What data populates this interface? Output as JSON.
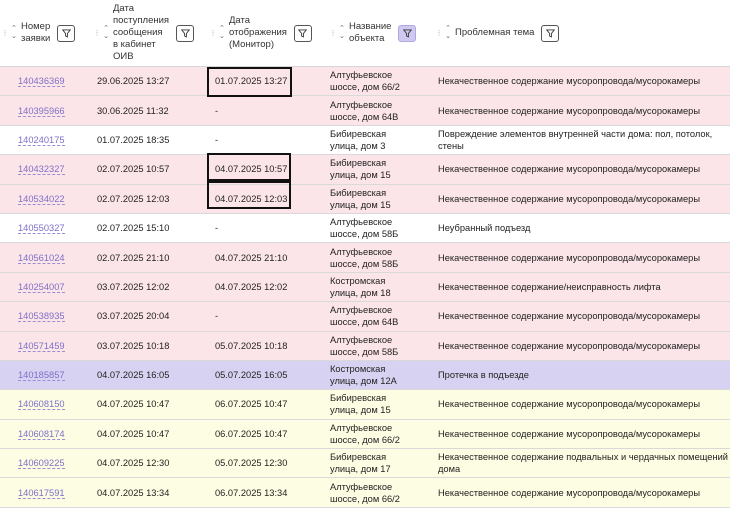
{
  "header": {
    "columns": [
      {
        "label_lines": [
          "Номер",
          "заявки"
        ],
        "filter": true,
        "filter_active": false
      },
      {
        "label_lines": [
          "Дата",
          "поступления",
          "сообщения",
          "в кабинет",
          "ОИВ"
        ],
        "filter": true,
        "filter_active": false
      },
      {
        "label_lines": [
          "Дата",
          "отображения",
          "(Монитор)"
        ],
        "filter": true,
        "filter_active": false
      },
      {
        "label_lines": [
          "Название",
          "объекта"
        ],
        "filter": true,
        "filter_active": true
      },
      {
        "label_lines": [
          "Проблемная тема"
        ],
        "filter": true,
        "filter_active": false
      }
    ]
  },
  "colors": {
    "pink": "#fce5e9",
    "violet": "#d7d2f1",
    "yellow": "#fdfde3",
    "link": "#7d6fc8"
  },
  "rows": [
    {
      "number": "140436369",
      "received": "29.06.2025 13:27",
      "displayed": "01.07.2025 13:27",
      "object": [
        "Алтуфьевское",
        "шоссе, дом 66/2"
      ],
      "topic": [
        "Некачественное содержание мусоропровода/мусорокамеры"
      ],
      "style": "pink"
    },
    {
      "number": "140395966",
      "received": "30.06.2025 11:32",
      "displayed": "-",
      "object": [
        "Алтуфьевское",
        "шоссе, дом 64В"
      ],
      "topic": [
        "Некачественное содержание мусоропровода/мусорокамеры"
      ],
      "style": "pink"
    },
    {
      "number": "140240175",
      "received": "01.07.2025 18:35",
      "displayed": "-",
      "object": [
        "Бибиревская",
        "улица, дом 3"
      ],
      "topic": [
        "Повреждение элементов внутренней части дома: пол, потолок,",
        "стены"
      ],
      "style": "white"
    },
    {
      "number": "140432327",
      "received": "02.07.2025 10:57",
      "displayed": "04.07.2025 10:57",
      "object": [
        "Бибиревская",
        "улица, дом 15"
      ],
      "topic": [
        "Некачественное содержание мусоропровода/мусорокамеры"
      ],
      "style": "pink"
    },
    {
      "number": "140534022",
      "received": "02.07.2025 12:03",
      "displayed": "04.07.2025 12:03",
      "object": [
        "Бибиревская",
        "улица, дом 15"
      ],
      "topic": [
        "Некачественное содержание мусоропровода/мусорокамеры"
      ],
      "style": "pink"
    },
    {
      "number": "140550327",
      "received": "02.07.2025 15:10",
      "displayed": "-",
      "object": [
        "Алтуфьевское",
        "шоссе, дом 58Б"
      ],
      "topic": [
        "Неубранный подъезд"
      ],
      "style": "white"
    },
    {
      "number": "140561024",
      "received": "02.07.2025 21:10",
      "displayed": "04.07.2025 21:10",
      "object": [
        "Алтуфьевское",
        "шоссе, дом 58Б"
      ],
      "topic": [
        "Некачественное содержание мусоропровода/мусорокамеры"
      ],
      "style": "pink"
    },
    {
      "number": "140254007",
      "received": "03.07.2025 12:02",
      "displayed": "04.07.2025 12:02",
      "object": [
        "Костромская",
        "улица, дом 18"
      ],
      "topic": [
        "Некачественное содержание/неисправность лифта"
      ],
      "style": "pink"
    },
    {
      "number": "140538935",
      "received": "03.07.2025 20:04",
      "displayed": "-",
      "object": [
        "Алтуфьевское",
        "шоссе, дом 64В"
      ],
      "topic": [
        "Некачественное содержание мусоропровода/мусорокамеры"
      ],
      "style": "pink"
    },
    {
      "number": "140571459",
      "received": "03.07.2025 10:18",
      "displayed": "05.07.2025 10:18",
      "object": [
        "Алтуфьевское",
        "шоссе, дом 58Б"
      ],
      "topic": [
        "Некачественное содержание мусоропровода/мусорокамеры"
      ],
      "style": "pink"
    },
    {
      "number": "140185857",
      "received": "04.07.2025 16:05",
      "displayed": "05.07.2025 16:05",
      "object": [
        "Костромская",
        "улица, дом 12А"
      ],
      "topic": [
        "Протечка в подъезде"
      ],
      "style": "violet"
    },
    {
      "number": "140608150",
      "received": "04.07.2025 10:47",
      "displayed": "06.07.2025 10:47",
      "object": [
        "Бибиревская",
        "улица, дом 15"
      ],
      "topic": [
        "Некачественное содержание мусоропровода/мусорокамеры"
      ],
      "style": "yellow"
    },
    {
      "number": "140608174",
      "received": "04.07.2025 10:47",
      "displayed": "06.07.2025 10:47",
      "object": [
        "Алтуфьевское",
        "шоссе, дом 66/2"
      ],
      "topic": [
        "Некачественное содержание мусоропровода/мусорокамеры"
      ],
      "style": "yellow"
    },
    {
      "number": "140609225",
      "received": "04.07.2025 12:30",
      "displayed": "05.07.2025 12:30",
      "object": [
        "Бибиревская",
        "улица, дом 17"
      ],
      "topic": [
        "Некачественное содержание подвальных и чердачных помещений",
        "дома"
      ],
      "style": "yellow"
    },
    {
      "number": "140617591",
      "received": "04.07.2025 13:34",
      "displayed": "06.07.2025 13:34",
      "object": [
        "Алтуфьевское",
        "шоссе, дом 66/2"
      ],
      "topic": [
        "Некачественное содержание мусоропровода/мусорокамеры"
      ],
      "style": "yellow"
    }
  ]
}
